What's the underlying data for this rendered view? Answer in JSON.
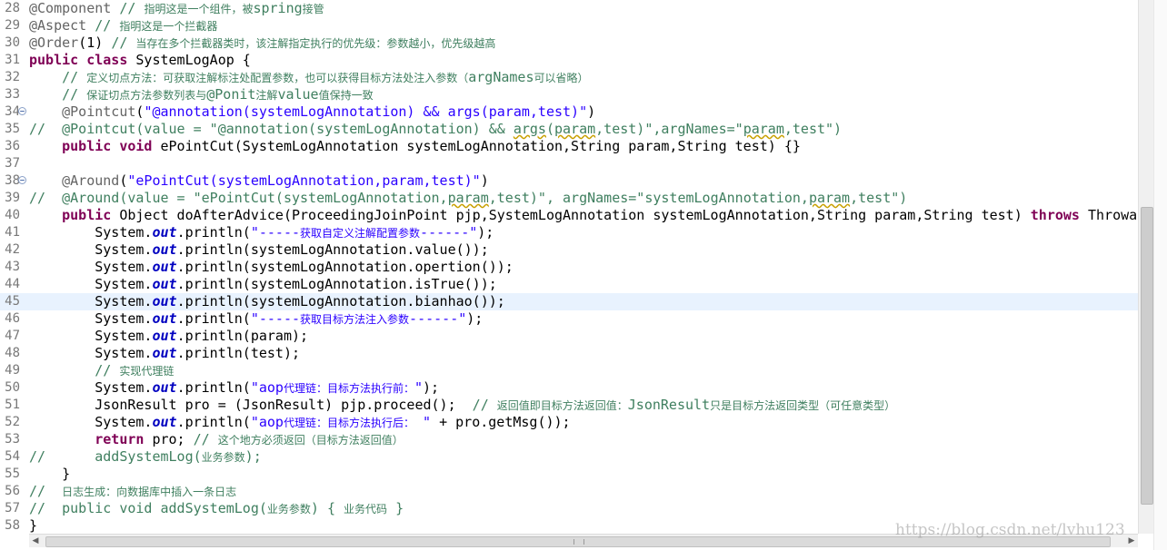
{
  "watermark": "https://blog.csdn.net/lvhu123",
  "lines": [
    {
      "n": "28",
      "fold": false,
      "hl": false,
      "tokens": [
        {
          "c": "an",
          "t": "@Component"
        },
        {
          "c": "",
          "t": " "
        },
        {
          "c": "cm",
          "t": "// "
        },
        {
          "c": "cm cjk",
          "t": "指明这是一个组件，被"
        },
        {
          "c": "cm",
          "t": "spring"
        },
        {
          "c": "cm cjk",
          "t": "接管"
        }
      ]
    },
    {
      "n": "29",
      "fold": false,
      "hl": false,
      "tokens": [
        {
          "c": "an",
          "t": "@Aspect"
        },
        {
          "c": "",
          "t": " "
        },
        {
          "c": "cm",
          "t": "// "
        },
        {
          "c": "cm cjk",
          "t": "指明这是一个拦截器"
        }
      ]
    },
    {
      "n": "30",
      "fold": false,
      "hl": false,
      "tokens": [
        {
          "c": "an",
          "t": "@Order"
        },
        {
          "c": "",
          "t": "(1) "
        },
        {
          "c": "cm",
          "t": "// "
        },
        {
          "c": "cm cjk",
          "t": "当存在多个拦截器类时，该注解指定执行的优先级：参数越小，优先级越高"
        }
      ]
    },
    {
      "n": "31",
      "fold": false,
      "hl": false,
      "tokens": [
        {
          "c": "kw",
          "t": "public"
        },
        {
          "c": "",
          "t": " "
        },
        {
          "c": "kw",
          "t": "class"
        },
        {
          "c": "",
          "t": " SystemLogAop {"
        }
      ]
    },
    {
      "n": "32",
      "fold": false,
      "hl": false,
      "tokens": [
        {
          "c": "",
          "t": "    "
        },
        {
          "c": "cm",
          "t": "// "
        },
        {
          "c": "cm cjk",
          "t": "定义切点方法：可获取注解标注处配置参数，也可以获得目标方法处注入参数（"
        },
        {
          "c": "cm",
          "t": "argNames"
        },
        {
          "c": "cm cjk",
          "t": "可以省略）"
        }
      ]
    },
    {
      "n": "33",
      "fold": false,
      "hl": false,
      "tokens": [
        {
          "c": "",
          "t": "    "
        },
        {
          "c": "cm",
          "t": "// "
        },
        {
          "c": "cm cjk",
          "t": "保证切点方法参数列表与"
        },
        {
          "c": "cm",
          "t": "@Ponit"
        },
        {
          "c": "cm cjk",
          "t": "注解"
        },
        {
          "c": "cm",
          "t": "value"
        },
        {
          "c": "cm cjk",
          "t": "值保持一致"
        }
      ]
    },
    {
      "n": "34",
      "fold": true,
      "hl": false,
      "tokens": [
        {
          "c": "",
          "t": "    "
        },
        {
          "c": "an",
          "t": "@Pointcut"
        },
        {
          "c": "",
          "t": "("
        },
        {
          "c": "st",
          "t": "\"@annotation(systemLogAnnotation) && args(param,test)\""
        },
        {
          "c": "",
          "t": ")"
        }
      ]
    },
    {
      "n": "35",
      "fold": false,
      "hl": false,
      "tokens": [
        {
          "c": "cm",
          "t": "//  @Pointcut(value = \"@annotation(systemLogAnnotation) && "
        },
        {
          "c": "cm wavy",
          "t": "args"
        },
        {
          "c": "cm",
          "t": "("
        },
        {
          "c": "cm wavy",
          "t": "param"
        },
        {
          "c": "cm",
          "t": ",test)\",argNames=\""
        },
        {
          "c": "cm wavy",
          "t": "param"
        },
        {
          "c": "cm",
          "t": ",test\")"
        }
      ]
    },
    {
      "n": "36",
      "fold": false,
      "hl": false,
      "tokens": [
        {
          "c": "",
          "t": "    "
        },
        {
          "c": "kw",
          "t": "public"
        },
        {
          "c": "",
          "t": " "
        },
        {
          "c": "kw",
          "t": "void"
        },
        {
          "c": "",
          "t": " ePointCut(SystemLogAnnotation systemLogAnnotation,String param,String test) {}"
        }
      ]
    },
    {
      "n": "37",
      "fold": false,
      "hl": false,
      "tokens": [
        {
          "c": "",
          "t": ""
        }
      ]
    },
    {
      "n": "38",
      "fold": true,
      "hl": false,
      "tokens": [
        {
          "c": "",
          "t": "    "
        },
        {
          "c": "an",
          "t": "@Around"
        },
        {
          "c": "",
          "t": "("
        },
        {
          "c": "st",
          "t": "\"ePointCut(systemLogAnnotation,param,test)\""
        },
        {
          "c": "",
          "t": ")"
        }
      ]
    },
    {
      "n": "39",
      "fold": false,
      "hl": false,
      "tokens": [
        {
          "c": "cm",
          "t": "//  @Around(value = \"ePointCut(systemLogAnnotation,"
        },
        {
          "c": "cm wavy",
          "t": "param"
        },
        {
          "c": "cm",
          "t": ",test)\", argNames=\"systemLogAnnotation,"
        },
        {
          "c": "cm wavy",
          "t": "param"
        },
        {
          "c": "cm",
          "t": ",test\")"
        }
      ]
    },
    {
      "n": "40",
      "fold": false,
      "hl": false,
      "tokens": [
        {
          "c": "",
          "t": "    "
        },
        {
          "c": "kw",
          "t": "public"
        },
        {
          "c": "",
          "t": " Object doAfterAdvice(ProceedingJoinPoint pjp,SystemLogAnnotation systemLogAnnotation,String param,String test) "
        },
        {
          "c": "kw",
          "t": "throws"
        },
        {
          "c": "",
          "t": " Throwable"
        }
      ]
    },
    {
      "n": "41",
      "fold": false,
      "hl": false,
      "tokens": [
        {
          "c": "",
          "t": "        System."
        },
        {
          "c": "fd",
          "t": "out"
        },
        {
          "c": "",
          "t": ".println("
        },
        {
          "c": "st",
          "t": "\"-----"
        },
        {
          "c": "st cjk",
          "t": "获取自定义注解配置参数"
        },
        {
          "c": "st",
          "t": "------\""
        },
        {
          "c": "",
          "t": ");"
        }
      ]
    },
    {
      "n": "42",
      "fold": false,
      "hl": false,
      "tokens": [
        {
          "c": "",
          "t": "        System."
        },
        {
          "c": "fd",
          "t": "out"
        },
        {
          "c": "",
          "t": ".println(systemLogAnnotation.value());"
        }
      ]
    },
    {
      "n": "43",
      "fold": false,
      "hl": false,
      "tokens": [
        {
          "c": "",
          "t": "        System."
        },
        {
          "c": "fd",
          "t": "out"
        },
        {
          "c": "",
          "t": ".println(systemLogAnnotation.opertion());"
        }
      ]
    },
    {
      "n": "44",
      "fold": false,
      "hl": false,
      "tokens": [
        {
          "c": "",
          "t": "        System."
        },
        {
          "c": "fd",
          "t": "out"
        },
        {
          "c": "",
          "t": ".println(systemLogAnnotation.isTrue());"
        }
      ]
    },
    {
      "n": "45",
      "fold": false,
      "hl": true,
      "tokens": [
        {
          "c": "",
          "t": "        System."
        },
        {
          "c": "fd",
          "t": "out"
        },
        {
          "c": "",
          "t": ".println(systemLogAnnotation.bianhao());"
        }
      ]
    },
    {
      "n": "46",
      "fold": false,
      "hl": false,
      "tokens": [
        {
          "c": "",
          "t": "        System."
        },
        {
          "c": "fd",
          "t": "out"
        },
        {
          "c": "",
          "t": ".println("
        },
        {
          "c": "st",
          "t": "\"-----"
        },
        {
          "c": "st cjk",
          "t": "获取目标方法注入参数"
        },
        {
          "c": "st",
          "t": "------\""
        },
        {
          "c": "",
          "t": ");"
        }
      ]
    },
    {
      "n": "47",
      "fold": false,
      "hl": false,
      "tokens": [
        {
          "c": "",
          "t": "        System."
        },
        {
          "c": "fd",
          "t": "out"
        },
        {
          "c": "",
          "t": ".println(param);"
        }
      ]
    },
    {
      "n": "48",
      "fold": false,
      "hl": false,
      "tokens": [
        {
          "c": "",
          "t": "        System."
        },
        {
          "c": "fd",
          "t": "out"
        },
        {
          "c": "",
          "t": ".println(test);"
        }
      ]
    },
    {
      "n": "49",
      "fold": false,
      "hl": false,
      "tokens": [
        {
          "c": "",
          "t": "        "
        },
        {
          "c": "cm",
          "t": "// "
        },
        {
          "c": "cm cjk",
          "t": "实现代理链"
        }
      ]
    },
    {
      "n": "50",
      "fold": false,
      "hl": false,
      "tokens": [
        {
          "c": "",
          "t": "        System."
        },
        {
          "c": "fd",
          "t": "out"
        },
        {
          "c": "",
          "t": ".println("
        },
        {
          "c": "st",
          "t": "\"aop"
        },
        {
          "c": "st cjk",
          "t": "代理链：目标方法执行前："
        },
        {
          "c": "st",
          "t": "\""
        },
        {
          "c": "",
          "t": ");"
        }
      ]
    },
    {
      "n": "51",
      "fold": false,
      "hl": false,
      "tokens": [
        {
          "c": "",
          "t": "        JsonResult pro = (JsonResult) pjp.proceed();  "
        },
        {
          "c": "cm",
          "t": "// "
        },
        {
          "c": "cm cjk",
          "t": "返回值即目标方法返回值："
        },
        {
          "c": "cm",
          "t": "JsonResult"
        },
        {
          "c": "cm cjk",
          "t": "只是目标方法返回类型（可任意类型）"
        }
      ]
    },
    {
      "n": "52",
      "fold": false,
      "hl": false,
      "tokens": [
        {
          "c": "",
          "t": "        System."
        },
        {
          "c": "fd",
          "t": "out"
        },
        {
          "c": "",
          "t": ".println("
        },
        {
          "c": "st",
          "t": "\"aop"
        },
        {
          "c": "st cjk",
          "t": "代理链：目标方法执行后："
        },
        {
          "c": "st",
          "t": " \""
        },
        {
          "c": "",
          "t": " + pro.getMsg());"
        }
      ]
    },
    {
      "n": "53",
      "fold": false,
      "hl": false,
      "tokens": [
        {
          "c": "",
          "t": "        "
        },
        {
          "c": "kw",
          "t": "return"
        },
        {
          "c": "",
          "t": " pro; "
        },
        {
          "c": "cm",
          "t": "// "
        },
        {
          "c": "cm cjk",
          "t": "这个地方必须返回（目标方法返回值）"
        }
      ]
    },
    {
      "n": "54",
      "fold": false,
      "hl": false,
      "tokens": [
        {
          "c": "cm",
          "t": "//      addSystemLog("
        },
        {
          "c": "cm cjk",
          "t": "业务参数"
        },
        {
          "c": "cm",
          "t": ");"
        }
      ]
    },
    {
      "n": "55",
      "fold": false,
      "hl": false,
      "tokens": [
        {
          "c": "",
          "t": "    }"
        }
      ]
    },
    {
      "n": "56",
      "fold": false,
      "hl": false,
      "tokens": [
        {
          "c": "cm",
          "t": "//  "
        },
        {
          "c": "cm cjk",
          "t": "日志生成：向数据库中插入一条日志"
        }
      ]
    },
    {
      "n": "57",
      "fold": false,
      "hl": false,
      "tokens": [
        {
          "c": "cm",
          "t": "//  public void addSystemLog("
        },
        {
          "c": "cm cjk",
          "t": "业务参数"
        },
        {
          "c": "cm",
          "t": ") { "
        },
        {
          "c": "cm cjk",
          "t": "业务代码"
        },
        {
          "c": "cm",
          "t": " }"
        }
      ]
    },
    {
      "n": "58",
      "fold": false,
      "hl": false,
      "tokens": [
        {
          "c": "",
          "t": "}"
        }
      ]
    }
  ]
}
